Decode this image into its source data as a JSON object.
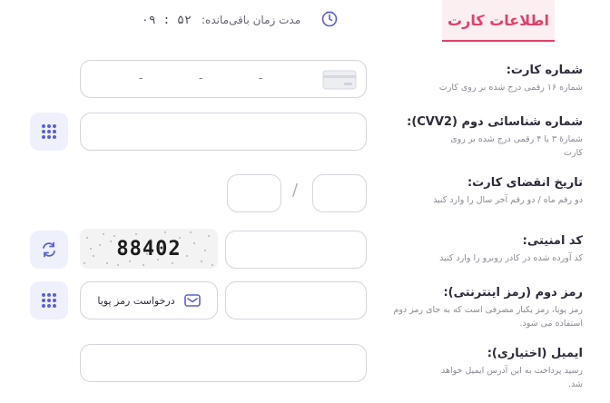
{
  "header": {
    "tab_label": "اطلاعات کارت",
    "timer_label": "مدت زمان باقی‌مانده:",
    "timer_value": "۰۹ : ۵۲"
  },
  "fields": {
    "card_number": {
      "label": "شماره کارت:",
      "hint": "شماره ۱۶ رقمی درج شده بر روی کارت",
      "placeholder_dashes": [
        "-",
        "-",
        "-"
      ]
    },
    "cvv2": {
      "label": "شماره شناسائی دوم (CVV2):",
      "hint": "شمارهٔ ۳ یا ۴ رقمی درج شده بر روی کارت"
    },
    "expiry": {
      "label": "تاریخ انقضای کارت:",
      "hint": "دو رقم ماه / دو رقم آخر سال را وارد کنید",
      "separator": "/"
    },
    "captcha": {
      "label": "کد امنیتی:",
      "hint": "کد آورده شده در کادر روبرو را وارد کنید",
      "image_text": "88402"
    },
    "pin2": {
      "label": "رمز دوم (رمز اینترنتی):",
      "hint": "رمز پویا، رمز یکبار مصرفی است که به جای رمز دوم استفاده می شود.",
      "dynamic_button": "درخواست رمز پویا"
    },
    "email": {
      "label": "ایمیل (اختیاری):",
      "hint": "رسید پرداخت به این آدرس ایمیل خواهد شد."
    }
  },
  "colors": {
    "accent": "#e0416a",
    "icon_accent": "#5b5fd6",
    "icon_bg": "#eef0fb"
  }
}
